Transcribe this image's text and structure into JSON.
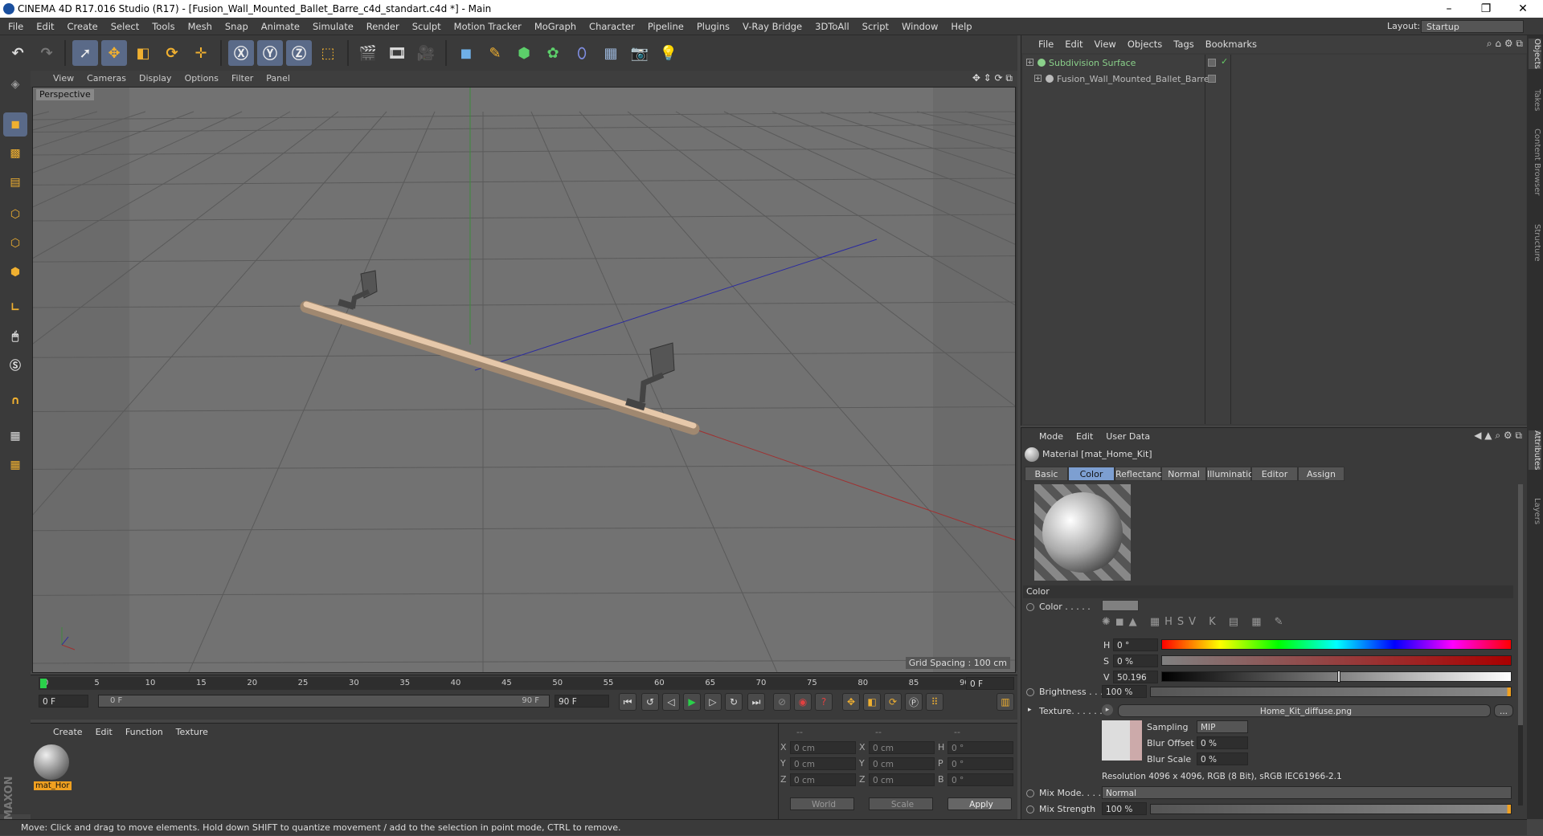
{
  "window": {
    "title": "CINEMA 4D R17.016 Studio (R17) - [Fusion_Wall_Mounted_Ballet_Barre_c4d_standart.c4d *] - Main",
    "layout_label": "Layout:",
    "layout_value": "Startup"
  },
  "menu": [
    "File",
    "Edit",
    "Create",
    "Select",
    "Tools",
    "Mesh",
    "Snap",
    "Animate",
    "Simulate",
    "Render",
    "Sculpt",
    "Motion Tracker",
    "MoGraph",
    "Character",
    "Pipeline",
    "Plugins",
    "V-Ray Bridge",
    "3DToAll",
    "Script",
    "Window",
    "Help"
  ],
  "viewport": {
    "menu": [
      "View",
      "Cameras",
      "Display",
      "Options",
      "Filter",
      "Panel"
    ],
    "label": "Perspective",
    "grid_spacing": "Grid Spacing : 100 cm"
  },
  "timeline": {
    "ticks": [
      "0",
      "5",
      "10",
      "15",
      "20",
      "25",
      "30",
      "35",
      "40",
      "45",
      "50",
      "55",
      "60",
      "65",
      "70",
      "75",
      "80",
      "85",
      "90"
    ],
    "current_frame": "0 F",
    "start": "0 F",
    "range_start": "0 F",
    "range_end": "90 F",
    "end": "90 F"
  },
  "material_manager": {
    "menu": [
      "Create",
      "Edit",
      "Function",
      "Texture"
    ],
    "material_name": "mat_Hor"
  },
  "coords": {
    "header": [
      "--",
      "--",
      "--"
    ],
    "rows": [
      {
        "a": "X",
        "av": "0 cm",
        "b": "X",
        "bv": "0 cm",
        "c": "H",
        "cv": "0 °"
      },
      {
        "a": "Y",
        "av": "0 cm",
        "b": "Y",
        "bv": "0 cm",
        "c": "P",
        "cv": "0 °"
      },
      {
        "a": "Z",
        "av": "0 cm",
        "b": "Z",
        "bv": "0 cm",
        "c": "B",
        "cv": "0 °"
      }
    ],
    "world": "World",
    "scale": "Scale",
    "apply": "Apply"
  },
  "status": "Move: Click and drag to move elements. Hold down SHIFT to quantize movement / add to the selection in point mode, CTRL to remove.",
  "objects": {
    "menu": [
      "File",
      "Edit",
      "View",
      "Objects",
      "Tags",
      "Bookmarks"
    ],
    "items": [
      {
        "name": "Subdivision Surface",
        "color": "#8ad08a"
      },
      {
        "name": "Fusion_Wall_Mounted_Ballet_Barre",
        "color": "#bbbbbb"
      }
    ]
  },
  "attributes": {
    "menu": [
      "Mode",
      "Edit",
      "User Data"
    ],
    "title": "Material [mat_Home_Kit]",
    "tabs": [
      "Basic",
      "Color",
      "Reflectance",
      "Normal",
      "Illumination",
      "Editor",
      "Assign"
    ],
    "active_tab": "Color",
    "section": "Color",
    "color_label": "Color . . . . .",
    "h_label": "H",
    "h_value": "0 °",
    "s_label": "S",
    "s_value": "0 %",
    "v_label": "V",
    "v_value": "50.196 %",
    "v_fraction": 0.50196,
    "brightness_label": "Brightness . . .",
    "brightness_value": "100 %",
    "texture_label": "Texture. . . . . .",
    "texture_file": "Home_Kit_diffuse.png",
    "texture_more": "...",
    "sampling_label": "Sampling",
    "sampling_value": "MIP",
    "blur_offset_label": "Blur Offset",
    "blur_offset_value": "0 %",
    "blur_scale_label": "Blur Scale",
    "blur_scale_value": "0 %",
    "resolution": "Resolution 4096 x 4096, RGB (8 Bit), sRGB IEC61966-2.1",
    "mix_mode_label": "Mix Mode. . . . .",
    "mix_mode_value": "Normal",
    "mix_strength_label": "Mix Strength",
    "mix_strength_value": "100 %"
  },
  "side_tabs": [
    "Objects",
    "Takes",
    "Content Browser",
    "Structure"
  ],
  "side_tabs_lower": [
    "Attributes",
    "Layers"
  ],
  "colors": {
    "accent": "#7d9fd1",
    "bg": "#3a3a3a",
    "viewport": "#6b6b6b"
  }
}
